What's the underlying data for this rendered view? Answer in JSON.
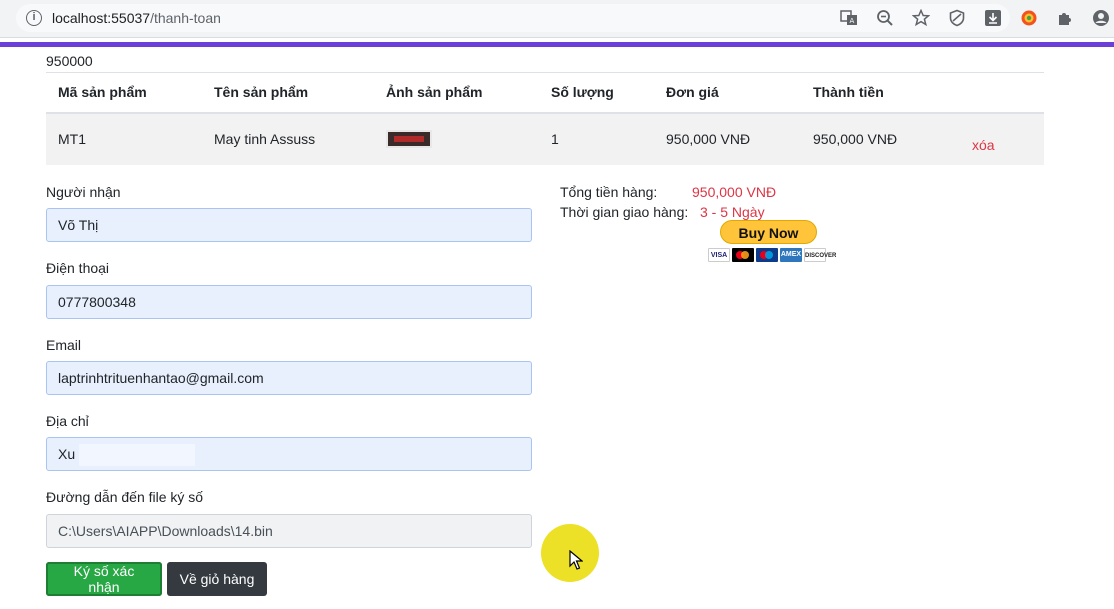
{
  "browser": {
    "url_host": "localhost:55037",
    "url_path": "/thanh-toan",
    "icons": [
      "translate-icon",
      "zoom-out-icon",
      "star-icon",
      "shield-icon",
      "download-icon",
      "extension-colorful-icon",
      "puzzle-icon",
      "profile-icon"
    ],
    "progress_color": "#6b3fd8"
  },
  "top_value": "950000",
  "table": {
    "headers": [
      "Mã sản phẩm",
      "Tên sản phẩm",
      "Ảnh sản phẩm",
      "Số lượng",
      "Đơn giá",
      "Thành tiền"
    ],
    "rows": [
      {
        "code": "MT1",
        "name": "May tinh Assuss",
        "image": "product-thumbnail",
        "quantity": "1",
        "unit_price": "950,000 VNĐ",
        "total": "950,000 VNĐ",
        "delete_label": "xóa"
      }
    ]
  },
  "form": {
    "recipient": {
      "label": "Người nhận",
      "value": "Võ Thị"
    },
    "phone": {
      "label": "Điện thoại",
      "value": "0777800348"
    },
    "email": {
      "label": "Email",
      "value": "laptrinhtrituenhantao@gmail.com"
    },
    "address": {
      "label": "Địa chỉ",
      "value": "Xu"
    },
    "file": {
      "label": "Đường dẫn đến file ký số",
      "value": "C:\\Users\\AIAPP\\Downloads\\14.bin"
    }
  },
  "buttons": {
    "confirm": "Ký số xác nhận",
    "back": "Về giỏ hàng"
  },
  "summary": {
    "total_label": "Tổng tiền hàng:",
    "total_value": "950,000 VNĐ",
    "delivery_label": "Thời gian giao hàng:",
    "delivery_value": "3 - 5 Ngày",
    "buy_now": "Buy Now",
    "card_brands": [
      "VISA",
      "mastercard",
      "maestro",
      "AMEX",
      "DISCOVER"
    ]
  },
  "colors": {
    "accent_red": "#dc3545",
    "confirm_green": "#28a745",
    "dark_button": "#343a40",
    "paypal_yellow": "#ffc439"
  }
}
